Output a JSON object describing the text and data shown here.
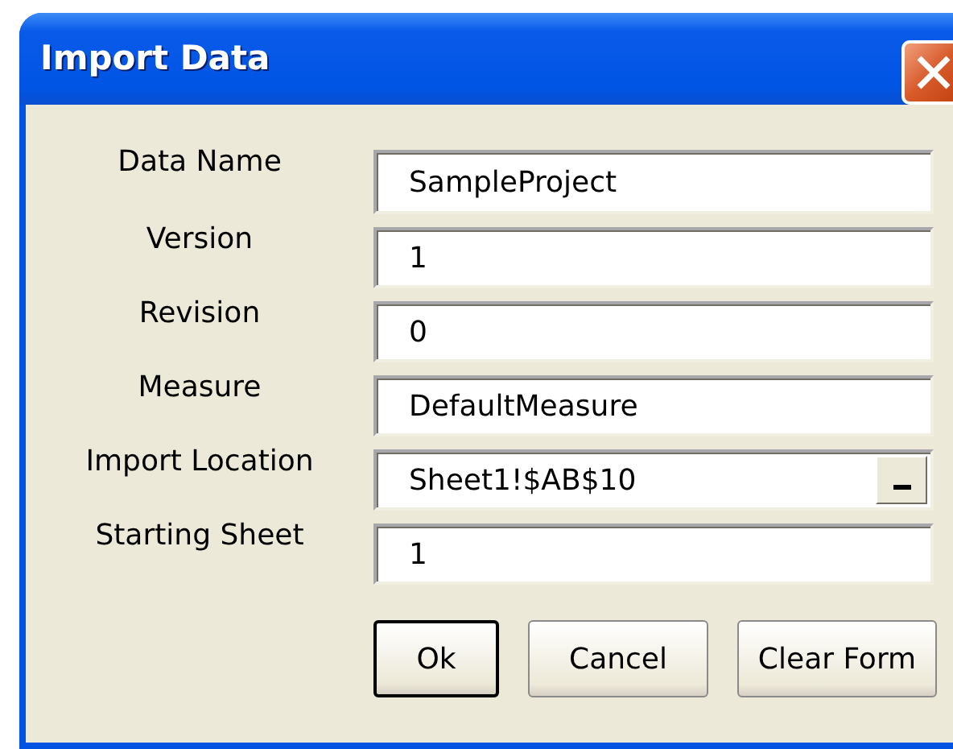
{
  "window": {
    "title": "Import Data"
  },
  "fields": [
    {
      "label": "Data Name",
      "value": "SampleProject",
      "kind": "text"
    },
    {
      "label": "Version",
      "value": "1",
      "kind": "text"
    },
    {
      "label": "Revision",
      "value": "0",
      "kind": "text"
    },
    {
      "label": "Measure",
      "value": "DefaultMeasure",
      "kind": "text"
    },
    {
      "label": "Import Location",
      "value": "Sheet1!$AB$10",
      "kind": "range"
    },
    {
      "label": "Starting Sheet",
      "value": "1",
      "kind": "text"
    }
  ],
  "buttons": [
    {
      "label": "Ok",
      "default": true
    },
    {
      "label": "Cancel",
      "default": false
    },
    {
      "label": "Clear Form",
      "default": false
    }
  ]
}
